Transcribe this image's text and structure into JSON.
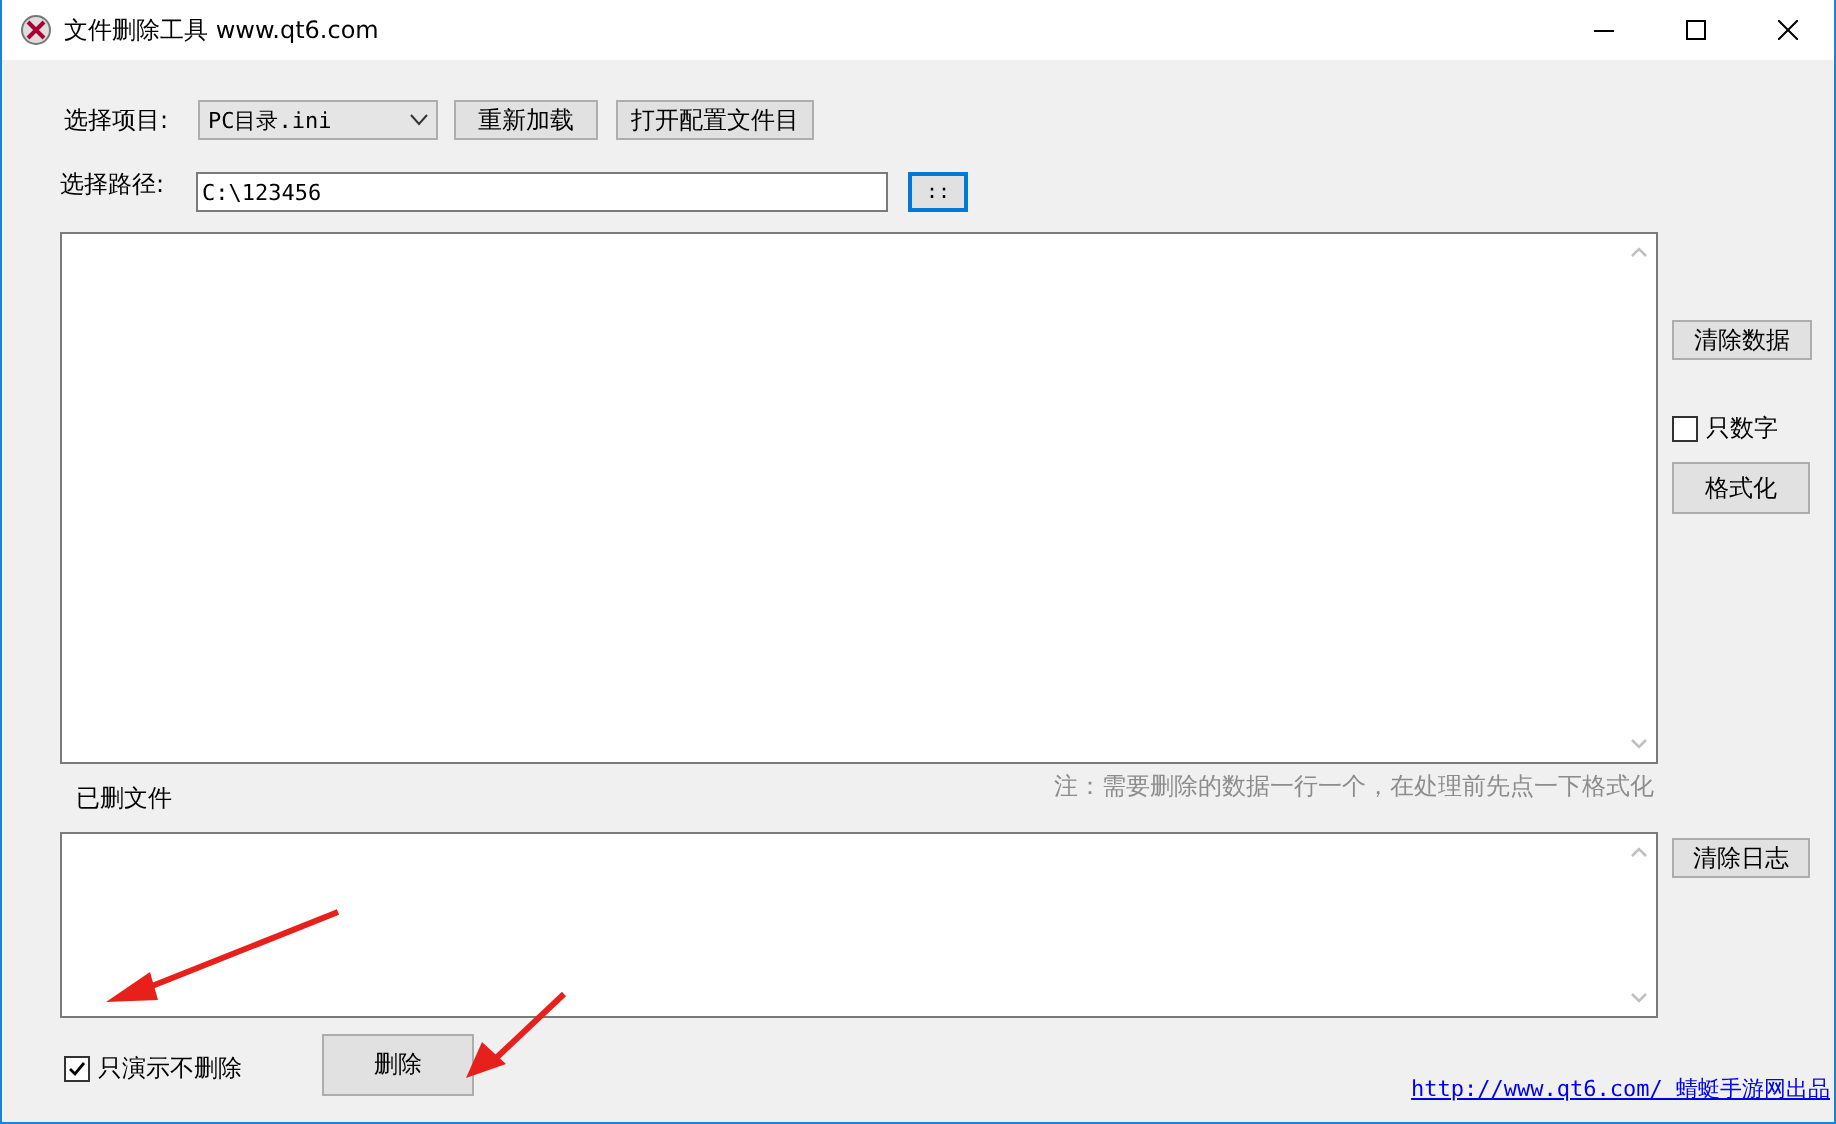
{
  "window": {
    "title": "文件删除工具 www.qt6.com"
  },
  "project": {
    "label": "选择项目:",
    "value": "PC目录.ini"
  },
  "toolbar_buttons": [
    "重新加载",
    "打开配置文件目"
  ],
  "path": {
    "label": "选择路径:",
    "value": "C:\\123456",
    "browse_button": "::"
  },
  "clear_data_button": "清除数据",
  "digits_only": {
    "label": "只数字",
    "checked": false
  },
  "format_button": "格式化",
  "note": "注：需要删除的数据一行一个，在处理前先点一下格式化",
  "deleted_files_label": "已删文件",
  "clear_log_button": "清除日志",
  "demo_only": {
    "label": "只演示不删除",
    "checked": true
  },
  "delete_button": "删除",
  "footer_link": "http://www.qt6.com/ 蜻蜓手游网出品"
}
